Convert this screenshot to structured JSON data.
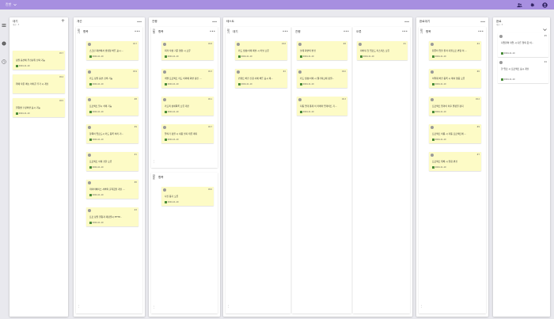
{
  "app": {
    "board_title": "칸반",
    "icons": [
      "users-icon",
      "settings-icon",
      "account-icon"
    ]
  },
  "rail": {
    "icons": [
      "list-icon",
      "info-icon",
      "history-icon"
    ]
  },
  "columns": [
    {
      "title": "대기",
      "subtitle": "제한 : 5",
      "cards": [
        {
          "num": "#17",
          "text": "정렬 옵션에 우선순위 선택 기능",
          "date": "2024-11-10"
        },
        {
          "num": "#14",
          "text": "위에 작은 메뉴 아이콘 추가 시 개선",
          "date": "2024-11-10"
        },
        {
          "num": "#15",
          "text": "컬럼명 수정하면 표시 기능",
          "date": "2024-11-10"
        }
      ]
    },
    {
      "title": "개선",
      "panels": [
        {
          "label": "항목",
          "vlabel": "대기",
          "cards": [
            {
              "num": "#17",
              "text": "스크린 화면에서 생텐형 버튼 표시 ...",
              "date": "2024-11-10"
            },
            {
              "num": "#19",
              "text": "카드 정렬 옵션 검색 기능",
              "date": "2024-11-10"
            },
            {
              "num": "#8",
              "text": "프로젝트 일시 삭제 기능",
              "date": "2024-11-10"
            },
            {
              "num": "#9",
              "text": "항목이 업로드시 카드 등록 처리 기...",
              "date": "2024-11-10"
            },
            {
              "num": "#1",
              "text": "프로젝트 삭제 경한 오류",
              "date": "2024-11-10"
            },
            {
              "num": "#6",
              "text": "데이터베이스 서버의 출력값을 개선 ...",
              "date": "2024-11-10"
            },
            {
              "num": "#3",
              "text": "프로 정렬 컬럼과 재정렬시 ETTP...",
              "date": "2024-11-10"
            }
          ]
        }
      ]
    },
    {
      "title": "진행",
      "panels": [
        {
          "label": "항목",
          "vlabel": "진행",
          "cards": [
            {
              "num": "#18",
              "text": "최저 작성 기준 영향 시 오류",
              "date": "2024-11-10"
            },
            {
              "num": "#13",
              "text": "레벨 프로젝트 카드 이외에 화면 갱신 ...",
              "date": "2024-11-10"
            },
            {
              "num": "#11",
              "text": "카드의 상세목록 오류 개선",
              "date": "2024-11-10"
            },
            {
              "num": "#17",
              "text": "알리기 정렬 시 내용 필지 태류 패지",
              "date": "2024-11-10"
            }
          ]
        },
        {
          "label": "항목",
          "vlabel": "완료",
          "cards": [
            {
              "num": "#10",
              "text": "사진 동기 오류",
              "date": "2024-11-10"
            }
          ]
        }
      ]
    },
    {
      "title": "테스트",
      "panels": [
        {
          "label": "대기",
          "vlabel": "대기",
          "cards": [
            {
              "num": "#18",
              "text": "카드 생성/삭제 패널 시 커널 오류",
              "date": "2024-11-10"
            },
            {
              "num": "#2",
              "text": "컨텐트 버전 신청 사에 버튼 표시 제...",
              "date": "2024-11-10"
            }
          ]
        },
        {
          "label": "진행",
          "cards": [
            {
              "num": "#8",
              "text": "설계 화면의 변경",
              "date": "2024-11-10"
            },
            {
              "num": "#10",
              "text": "카드 생성/삭제 시 웹가져오에 정렬...",
              "date": "2024-11-10"
            },
            {
              "num": "#13",
              "text": "자동 업데 통계 이 카메라 업데이트 기...",
              "date": "2024-11-10"
            }
          ]
        },
        {
          "label": "오류",
          "cards": [
            {
              "num": "#1",
              "text": "피바뀌 첫 업로드 카스테스 오류",
              "date": "2024-11-10"
            }
          ]
        }
      ]
    },
    {
      "title": "완료대기",
      "panels": [
        {
          "label": "항목",
          "vlabel": "대기",
          "cards": [
            {
              "num": "#4",
              "text": "컴퓨터 업을 원격 지원으로 변형 이 ...",
              "date": "2024-11-10"
            },
            {
              "num": "#6",
              "text": "어려워 버전 등록 시 에서 영웅 오류",
              "date": "2024-11-10"
            },
            {
              "num": "#12",
              "text": "프로젝트 엄격이 이후 결정일 정지",
              "date": "2024-11-10"
            },
            {
              "num": "#9",
              "text": "프로젝트 이름 시 자동 프로젝트에 ...",
              "date": "2024-11-10"
            },
            {
              "num": "#7",
              "text": "프로젝트 위해 시 컬럼 변경",
              "date": "2024-11-10"
            }
          ]
        }
      ]
    },
    {
      "title": "완료",
      "subtitle": "제한 : 5",
      "cards": [
        {
          "num": "#5",
          "text": "지업완의 작업 시 다른 임의 값 이...",
          "date": "2024-11-10"
        },
        {
          "num": "#4",
          "text": "한 업로 시 프로젝트 표시 개선",
          "date": "2024-11-10"
        }
      ]
    }
  ]
}
